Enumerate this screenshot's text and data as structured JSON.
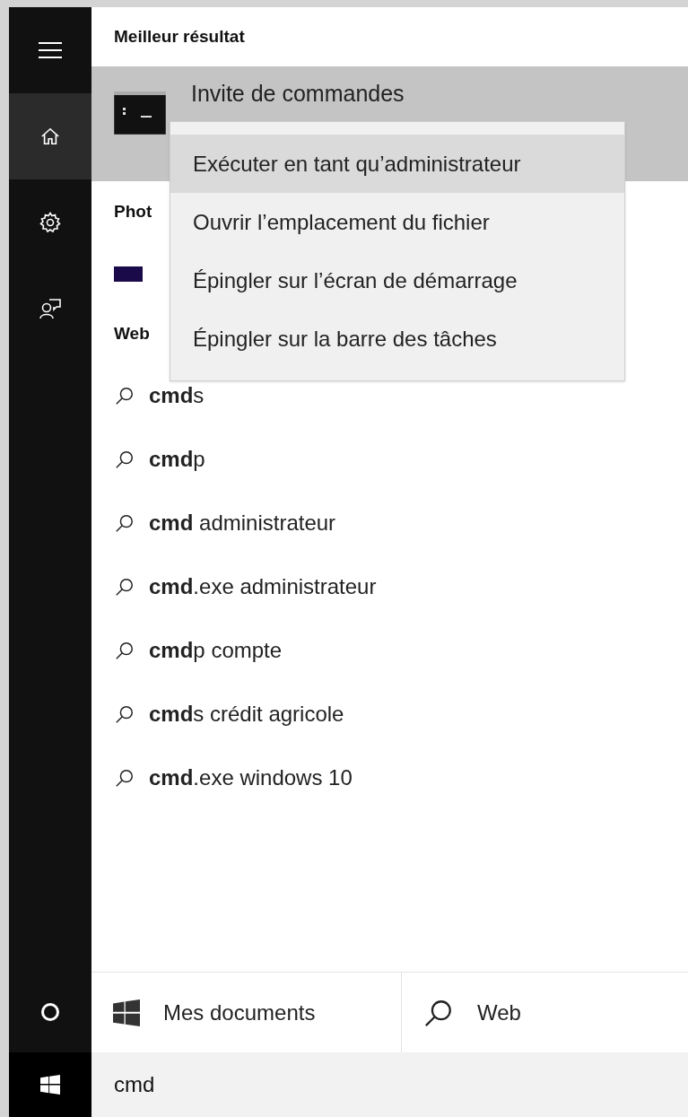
{
  "sidebar": {
    "items": [
      {
        "kind": "menu",
        "selected": false
      },
      {
        "kind": "home",
        "selected": true
      },
      {
        "kind": "settings",
        "selected": false
      },
      {
        "kind": "feedback",
        "selected": false
      }
    ],
    "bottom": [
      {
        "kind": "cortana",
        "selected": false
      },
      {
        "kind": "start",
        "selected": false
      }
    ]
  },
  "best_result": {
    "heading": "Meilleur résultat",
    "item": {
      "title": "Invite de commandes",
      "selected": true
    }
  },
  "photos": {
    "heading": "Phot"
  },
  "web": {
    "heading": "Web",
    "suggestions": [
      "**cmd**s",
      "**cmd**p",
      "**cmd** administrateur",
      "**cmd**.exe administrateur",
      "**cmd**p compte",
      "**cmd**s crédit agricole",
      "**cmd**.exe windows 10"
    ]
  },
  "context_menu": [
    {
      "label": "Exécuter en tant qu’administrateur",
      "selected": true
    },
    {
      "label": "Ouvrir l’emplacement du fichier",
      "selected": false
    },
    {
      "label": "Épingler sur l’écran de démarrage",
      "selected": false
    },
    {
      "label": "Épingler sur la barre des tâches",
      "selected": false
    }
  ],
  "filters": [
    {
      "kind": "documents",
      "label": "Mes documents"
    },
    {
      "kind": "web",
      "label": "Web"
    }
  ],
  "search": {
    "value": "cmd"
  }
}
